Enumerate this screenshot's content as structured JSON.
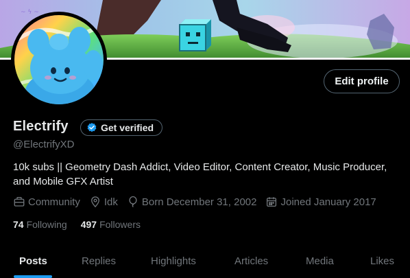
{
  "profile": {
    "name": "Electrify",
    "handle": "@ElectrifyXD",
    "verify_label": "Get verified",
    "edit_label": "Edit profile",
    "bio_line1": "10k subs || Geometry Dash Addict, Video Editor, Content Creator, Music Producer,",
    "bio_line2": "and Mobile GFX Artist",
    "meta": {
      "category": "Community",
      "location": "Idk",
      "born": "Born December 31, 2002",
      "joined": "Joined January 2017"
    },
    "counts": {
      "following_num": "74",
      "following_label": "Following",
      "followers_num": "497",
      "followers_label": "Followers"
    }
  },
  "tabs": {
    "posts": "Posts",
    "replies": "Replies",
    "highlights": "Highlights",
    "articles": "Articles",
    "media": "Media",
    "likes": "Likes"
  },
  "colors": {
    "accent": "#1d9bf0",
    "text_primary": "#e7e9ea",
    "text_secondary": "#71767b",
    "border": "#536471",
    "background": "#000000"
  },
  "icons": {
    "category": "briefcase-icon",
    "location": "location-pin-icon",
    "birthday": "balloon-icon",
    "joined": "calendar-icon",
    "verified": "verified-badge-icon"
  }
}
